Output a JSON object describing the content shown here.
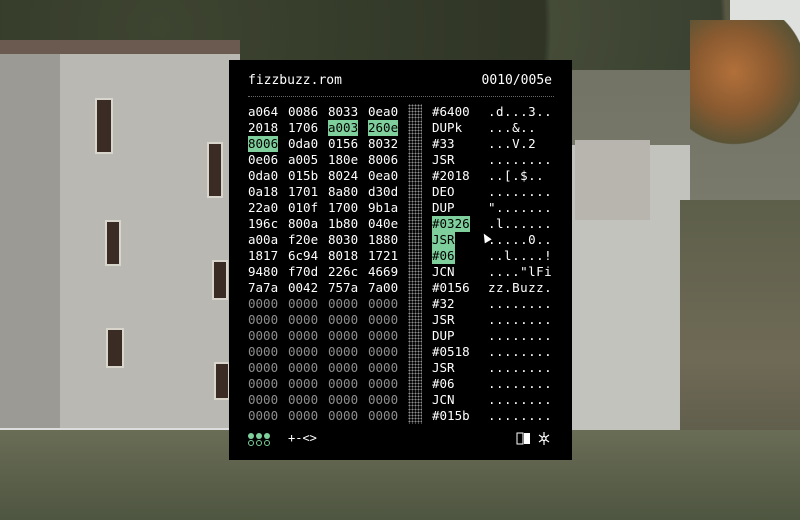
{
  "window": {
    "title": "fizzbuzz.rom",
    "counter": "0010/005e"
  },
  "colors": {
    "accent": "#7fcf9c",
    "background": "#000000",
    "text": "#ffffff"
  },
  "rows": [
    {
      "hex": [
        "a064",
        "0086",
        "8033",
        "0ea0"
      ],
      "op": "#6400",
      "ascii": ".d...3.."
    },
    {
      "hex": [
        "2018",
        "1706",
        "a003",
        "260e"
      ],
      "op": "DUPk",
      "ascii": "...&.."
    },
    {
      "hex": [
        "8006",
        "0da0",
        "0156",
        "8032"
      ],
      "op": "#33",
      "ascii": "...V.2"
    },
    {
      "hex": [
        "0e06",
        "a005",
        "180e",
        "8006"
      ],
      "op": "JSR",
      "ascii": "........"
    },
    {
      "hex": [
        "0da0",
        "015b",
        "8024",
        "0ea0"
      ],
      "op": "#2018",
      "ascii": "..[.$.."
    },
    {
      "hex": [
        "0a18",
        "1701",
        "8a80",
        "d30d"
      ],
      "op": "DEO",
      "ascii": "........"
    },
    {
      "hex": [
        "22a0",
        "010f",
        "1700",
        "9b1a"
      ],
      "op": "DUP",
      "ascii": "\"......."
    },
    {
      "hex": [
        "196c",
        "800a",
        "1b80",
        "040e"
      ],
      "op": "#0326",
      "ascii": ".l......"
    },
    {
      "hex": [
        "a00a",
        "f20e",
        "8030",
        "1880"
      ],
      "op": "JSR",
      "ascii": ".....0.."
    },
    {
      "hex": [
        "1817",
        "6c94",
        "8018",
        "1721"
      ],
      "op": "#06",
      "ascii": "..l....!"
    },
    {
      "hex": [
        "9480",
        "f70d",
        "226c",
        "4669"
      ],
      "op": "JCN",
      "ascii": "....\"lFi"
    },
    {
      "hex": [
        "7a7a",
        "0042",
        "757a",
        "7a00"
      ],
      "op": "#0156",
      "ascii": "zz.Buzz."
    },
    {
      "hex": [
        "0000",
        "0000",
        "0000",
        "0000"
      ],
      "op": "#32",
      "ascii": "........"
    },
    {
      "hex": [
        "0000",
        "0000",
        "0000",
        "0000"
      ],
      "op": "JSR",
      "ascii": "........"
    },
    {
      "hex": [
        "0000",
        "0000",
        "0000",
        "0000"
      ],
      "op": "DUP",
      "ascii": "........"
    },
    {
      "hex": [
        "0000",
        "0000",
        "0000",
        "0000"
      ],
      "op": "#0518",
      "ascii": "........"
    },
    {
      "hex": [
        "0000",
        "0000",
        "0000",
        "0000"
      ],
      "op": "JSR",
      "ascii": "........"
    },
    {
      "hex": [
        "0000",
        "0000",
        "0000",
        "0000"
      ],
      "op": "#06",
      "ascii": "........"
    },
    {
      "hex": [
        "0000",
        "0000",
        "0000",
        "0000"
      ],
      "op": "JCN",
      "ascii": "........"
    },
    {
      "hex": [
        "0000",
        "0000",
        "0000",
        "0000"
      ],
      "op": "#015b",
      "ascii": "........"
    }
  ],
  "highlights": {
    "hex": [
      [
        1,
        2
      ],
      [
        1,
        3
      ],
      [
        2,
        0
      ]
    ],
    "op": [
      7,
      8,
      9
    ]
  },
  "footer": {
    "mode_dots": [
      "filled",
      "filled",
      "filled",
      "hollow",
      "hollow",
      "hollow"
    ],
    "controls": "+-<>",
    "icons": [
      "memory-bank-icon",
      "sun-icon"
    ]
  }
}
